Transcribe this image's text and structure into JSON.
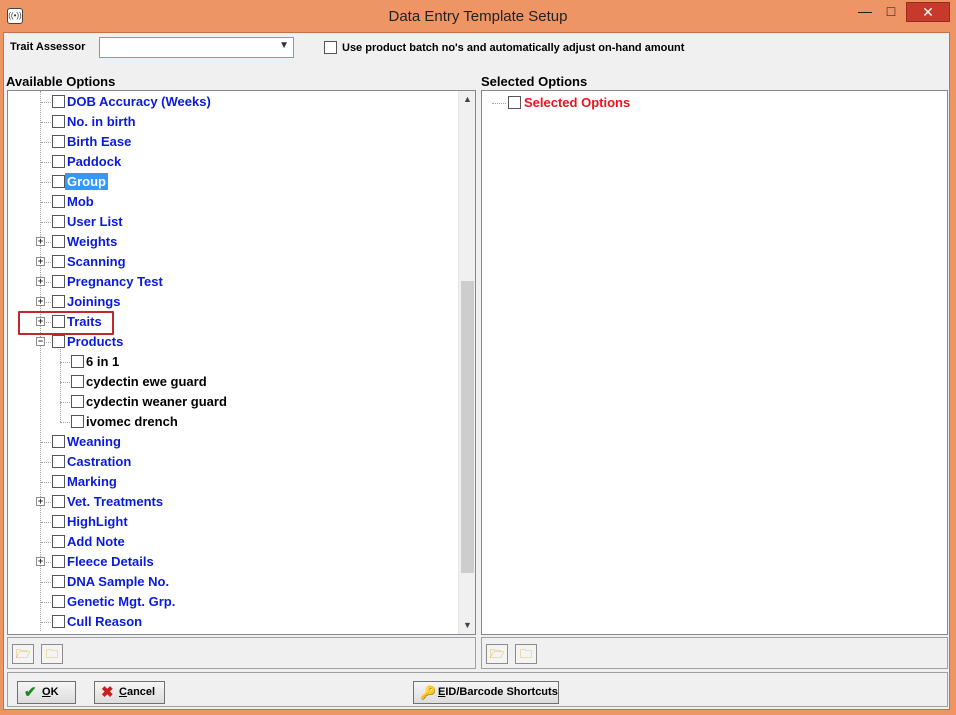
{
  "window": {
    "title": "Data Entry Template Setup",
    "icon": "app-icon",
    "close_glyph": "✕",
    "max_glyph": "□",
    "min_glyph": "—"
  },
  "top": {
    "trait_assessor_label": "Trait Assessor",
    "trait_assessor_value": "",
    "batch_checkbox_label": "Use product batch no's and automatically adjust on-hand amount",
    "batch_checked": false
  },
  "available": {
    "title": "Available Options",
    "items": [
      {
        "label": "DOB Accuracy (Weeks)",
        "level": 0,
        "expander": ""
      },
      {
        "label": "No. in birth",
        "level": 0,
        "expander": ""
      },
      {
        "label": "Birth Ease",
        "level": 0,
        "expander": ""
      },
      {
        "label": "Paddock",
        "level": 0,
        "expander": ""
      },
      {
        "label": "Group",
        "level": 0,
        "expander": "",
        "selected": true
      },
      {
        "label": "Mob",
        "level": 0,
        "expander": ""
      },
      {
        "label": "User List",
        "level": 0,
        "expander": ""
      },
      {
        "label": "Weights",
        "level": 0,
        "expander": "+"
      },
      {
        "label": "Scanning",
        "level": 0,
        "expander": "+"
      },
      {
        "label": "Pregnancy Test",
        "level": 0,
        "expander": "+"
      },
      {
        "label": "Joinings",
        "level": 0,
        "expander": "+"
      },
      {
        "label": "Traits",
        "level": 0,
        "expander": "+"
      },
      {
        "label": "Products",
        "level": 0,
        "expander": "−"
      },
      {
        "label": "6 in 1",
        "level": 1,
        "expander": ""
      },
      {
        "label": "cydectin ewe guard",
        "level": 1,
        "expander": ""
      },
      {
        "label": "cydectin weaner guard",
        "level": 1,
        "expander": ""
      },
      {
        "label": "ivomec drench",
        "level": 1,
        "expander": ""
      },
      {
        "label": "Weaning",
        "level": 0,
        "expander": ""
      },
      {
        "label": "Castration",
        "level": 0,
        "expander": ""
      },
      {
        "label": "Marking",
        "level": 0,
        "expander": ""
      },
      {
        "label": "Vet. Treatments",
        "level": 0,
        "expander": "+"
      },
      {
        "label": "HighLight",
        "level": 0,
        "expander": ""
      },
      {
        "label": "Add Note",
        "level": 0,
        "expander": ""
      },
      {
        "label": "Fleece Details",
        "level": 0,
        "expander": "+"
      },
      {
        "label": "DNA Sample No.",
        "level": 0,
        "expander": ""
      },
      {
        "label": "Genetic Mgt. Grp.",
        "level": 0,
        "expander": ""
      },
      {
        "label": "Cull Reason",
        "level": 0,
        "expander": ""
      }
    ]
  },
  "selected": {
    "title": "Selected Options",
    "root_label": "Selected Options",
    "root_color": "#e8141e"
  },
  "buttons": {
    "ok_icon_glyph": "✔",
    "ok_prefix": "",
    "ok_underlined": "O",
    "ok_rest": "K",
    "cancel_icon_glyph": "✖",
    "cancel_underlined": "C",
    "cancel_rest": "ancel",
    "eid_icon_glyph": "🔑",
    "eid_underlined": "E",
    "eid_rest": "ID/Barcode Shortcuts"
  },
  "toolbar_icons": {
    "open_folder": "🗁",
    "folder": "🗀"
  }
}
